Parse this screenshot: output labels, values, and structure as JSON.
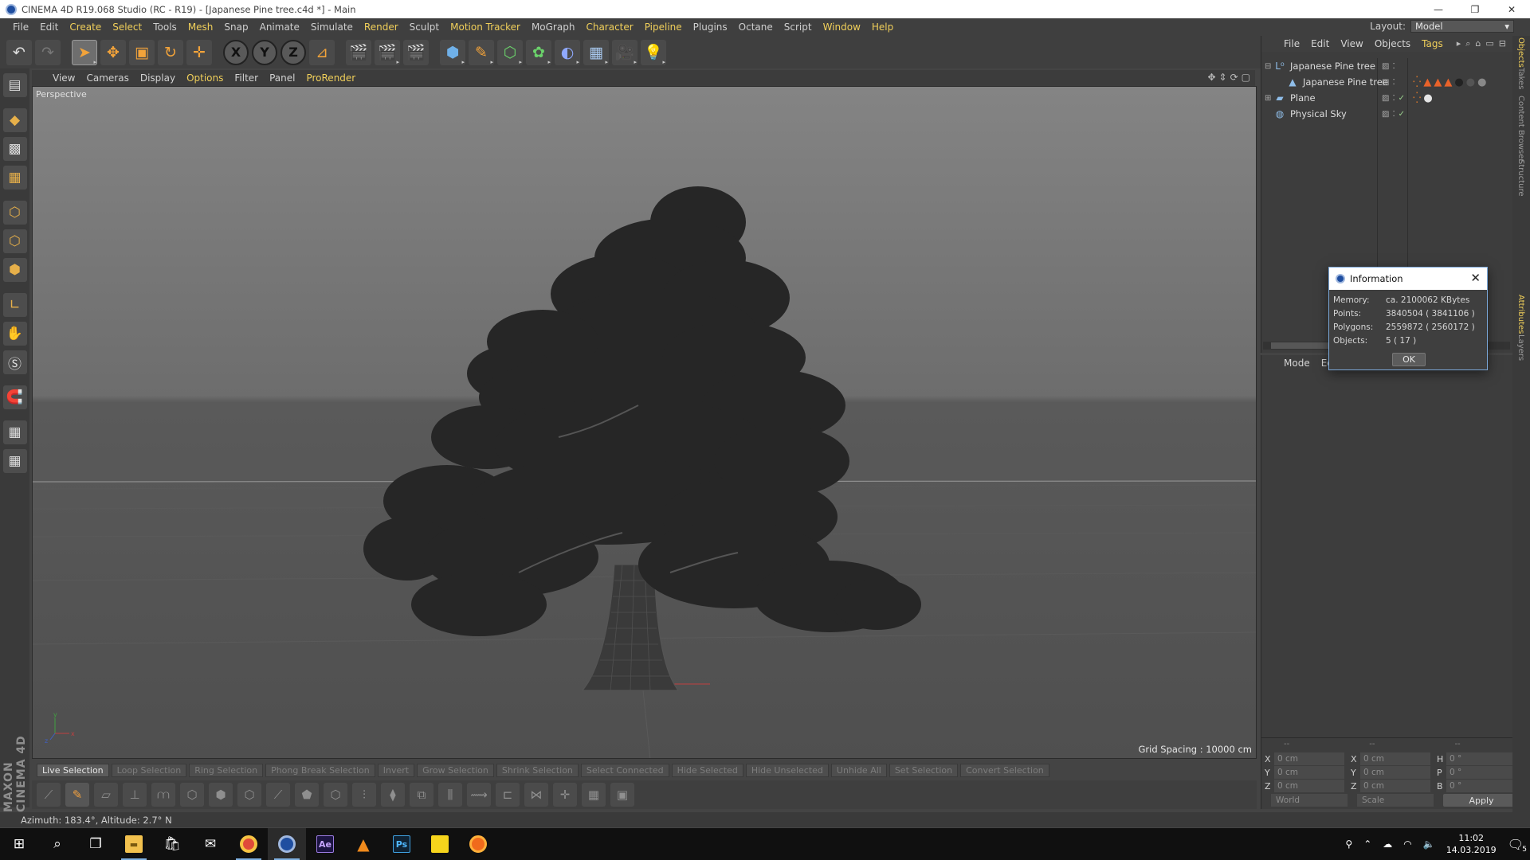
{
  "window": {
    "title": "CINEMA 4D R19.068 Studio (RC - R19) - [Japanese Pine tree.c4d *] - Main",
    "controls": [
      "—",
      "❐",
      "✕"
    ]
  },
  "menubar": {
    "items": [
      "File",
      "Edit",
      "Create",
      "Select",
      "Tools",
      "Mesh",
      "Snap",
      "Animate",
      "Simulate",
      "Render",
      "Sculpt",
      "Motion Tracker",
      "MoGraph",
      "Character",
      "Pipeline",
      "Plugins",
      "Octane",
      "Script",
      "Window",
      "Help"
    ],
    "highlighted": [
      "Create",
      "Select",
      "Mesh",
      "Render",
      "Motion Tracker",
      "Character",
      "Pipeline",
      "Window",
      "Help"
    ]
  },
  "layout": {
    "label": "Layout:",
    "value": "Model"
  },
  "viewport": {
    "menu": [
      "View",
      "Cameras",
      "Display",
      "Options",
      "Filter",
      "Panel",
      "ProRender"
    ],
    "menu_highlighted": [
      "Options",
      "ProRender"
    ],
    "label": "Perspective",
    "grid_spacing": "Grid Spacing : 10000 cm"
  },
  "selection_bar": {
    "items": [
      "Live Selection",
      "Loop Selection",
      "Ring Selection",
      "Phong Break Selection",
      "Invert",
      "Grow Selection",
      "Shrink Selection",
      "Select Connected",
      "Hide Selected",
      "Hide Unselected",
      "Unhide All",
      "Set Selection",
      "Convert Selection"
    ],
    "active": "Live Selection"
  },
  "status": {
    "text": "Azimuth: 183.4°, Altitude: 2.7°  N"
  },
  "object_manager": {
    "menu": [
      "File",
      "Edit",
      "View",
      "Objects",
      "Tags"
    ],
    "menu_highlighted": [
      "Tags"
    ],
    "objects": [
      {
        "name": "Japanese Pine tree",
        "icon": "null-icon",
        "indent": 0,
        "expand": "⊟"
      },
      {
        "name": "Japanese Pine tree",
        "icon": "polygon-icon",
        "indent": 1,
        "expand": ""
      },
      {
        "name": "Plane",
        "icon": "plane-icon",
        "indent": 0,
        "expand": "⊞"
      },
      {
        "name": "Physical Sky",
        "icon": "sky-icon",
        "indent": 0,
        "expand": ""
      }
    ]
  },
  "attribute_manager": {
    "menu": [
      "Mode",
      "Edit"
    ]
  },
  "coordinates": {
    "rows": [
      {
        "a": "X",
        "av": "0 cm",
        "b": "X",
        "bv": "0 cm",
        "c": "H",
        "cv": "0 °"
      },
      {
        "a": "Y",
        "av": "0 cm",
        "b": "Y",
        "bv": "0 cm",
        "c": "P",
        "cv": "0 °"
      },
      {
        "a": "Z",
        "av": "0 cm",
        "b": "Z",
        "bv": "0 cm",
        "c": "B",
        "cv": "0 °"
      }
    ],
    "header_dashes": [
      "--",
      "--",
      "--"
    ],
    "world": "World",
    "scale": "Scale",
    "apply": "Apply"
  },
  "side_tabs": [
    "Objects",
    "Takes",
    "Content Browser",
    "Structure",
    "Attributes",
    "Layers"
  ],
  "info_dialog": {
    "title": "Information",
    "rows": [
      {
        "key": "Memory:",
        "value": "ca. 2100062 KBytes"
      },
      {
        "key": "Points:",
        "value": "3840504 ( 3841106 )"
      },
      {
        "key": "Polygons:",
        "value": "2559872 ( 2560172 )"
      },
      {
        "key": "Objects:",
        "value": "5 ( 17 )"
      }
    ],
    "ok": "OK"
  },
  "left_logo": "MAXON CINEMA 4D",
  "taskbar": {
    "apps": [
      "windows-start-icon",
      "search-icon",
      "task-view-icon",
      "file-explorer-icon",
      "store-icon",
      "mail-icon",
      "chrome-icon",
      "cinema4d-icon",
      "after-effects-icon",
      "vlc-icon",
      "photoshop-icon",
      "sticky-notes-icon",
      "firefox-icon"
    ],
    "ae_label": "Ae",
    "ps_label": "Ps",
    "time": "11:02",
    "date": "14.03.2019",
    "notification_count": "5"
  },
  "colors": {
    "accent_yellow": "#f0cf5a",
    "ui_dark": "#3f3f3f",
    "viewport_top": "#848484",
    "dialog_border": "#7aa7d8"
  }
}
